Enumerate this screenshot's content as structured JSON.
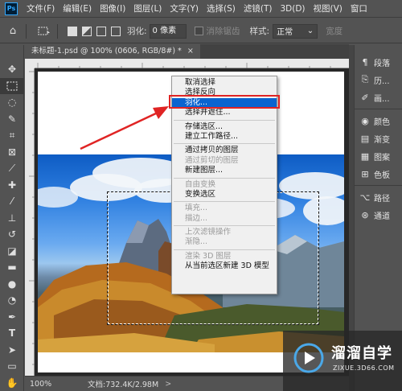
{
  "app": {
    "logo": "Ps"
  },
  "menubar": [
    "文件(F)",
    "编辑(E)",
    "图像(I)",
    "图层(L)",
    "文字(Y)",
    "选择(S)",
    "滤镜(T)",
    "3D(D)",
    "视图(V)",
    "窗口"
  ],
  "optbar": {
    "feather_label": "羽化:",
    "feather_value": "0 像素",
    "antialias_label": "消除锯齿",
    "style_label": "样式:",
    "style_value": "正常",
    "width_label": "宽度"
  },
  "document": {
    "tab_title": "未标题-1.psd @ 100% (0606, RGB/8#) *",
    "tab_close": "×"
  },
  "context_menu": {
    "groups": [
      [
        {
          "label": "取消选择",
          "disabled": false
        },
        {
          "label": "选择反向",
          "disabled": false
        },
        {
          "label": "羽化...",
          "disabled": false,
          "highlighted": true
        },
        {
          "label": "选择并遮住...",
          "disabled": false
        }
      ],
      [
        {
          "label": "存储选区...",
          "disabled": false
        },
        {
          "label": "建立工作路径...",
          "disabled": false
        }
      ],
      [
        {
          "label": "通过拷贝的图层",
          "disabled": false
        },
        {
          "label": "通过剪切的图层",
          "disabled": true
        },
        {
          "label": "新建图层...",
          "disabled": false
        }
      ],
      [
        {
          "label": "自由变换",
          "disabled": true
        },
        {
          "label": "变换选区",
          "disabled": false
        }
      ],
      [
        {
          "label": "填充...",
          "disabled": true
        },
        {
          "label": "描边...",
          "disabled": true
        }
      ],
      [
        {
          "label": "上次滤镜操作",
          "disabled": true
        },
        {
          "label": "渐隐...",
          "disabled": true
        }
      ],
      [
        {
          "label": "渲染 3D 图层",
          "disabled": true
        },
        {
          "label": "从当前选区新建 3D 模型",
          "disabled": false
        }
      ]
    ]
  },
  "right_panel": {
    "group1": [
      {
        "icon": "paragraph-icon",
        "label": "段落"
      },
      {
        "icon": "history-icon",
        "label": "历..."
      },
      {
        "icon": "brush-icon",
        "label": "画..."
      }
    ],
    "group2": [
      {
        "icon": "color-icon",
        "label": "颜色"
      },
      {
        "icon": "gradient-icon",
        "label": "渐变"
      },
      {
        "icon": "pattern-icon",
        "label": "图案"
      },
      {
        "icon": "swatches-icon",
        "label": "色板"
      }
    ],
    "group3": [
      {
        "icon": "paths-icon",
        "label": "路径"
      },
      {
        "icon": "channels-icon",
        "label": "通道"
      }
    ]
  },
  "status": {
    "zoom": "100%",
    "doc_info": "文档:732.4K/2.98M",
    "arrow": ">"
  },
  "watermark": {
    "title": "溜溜自学",
    "url": "ZIXUE.3D66.COM"
  },
  "colors": {
    "highlight": "#0a64d0",
    "annotation_red": "#e02424",
    "ui_gray": "#535353"
  }
}
